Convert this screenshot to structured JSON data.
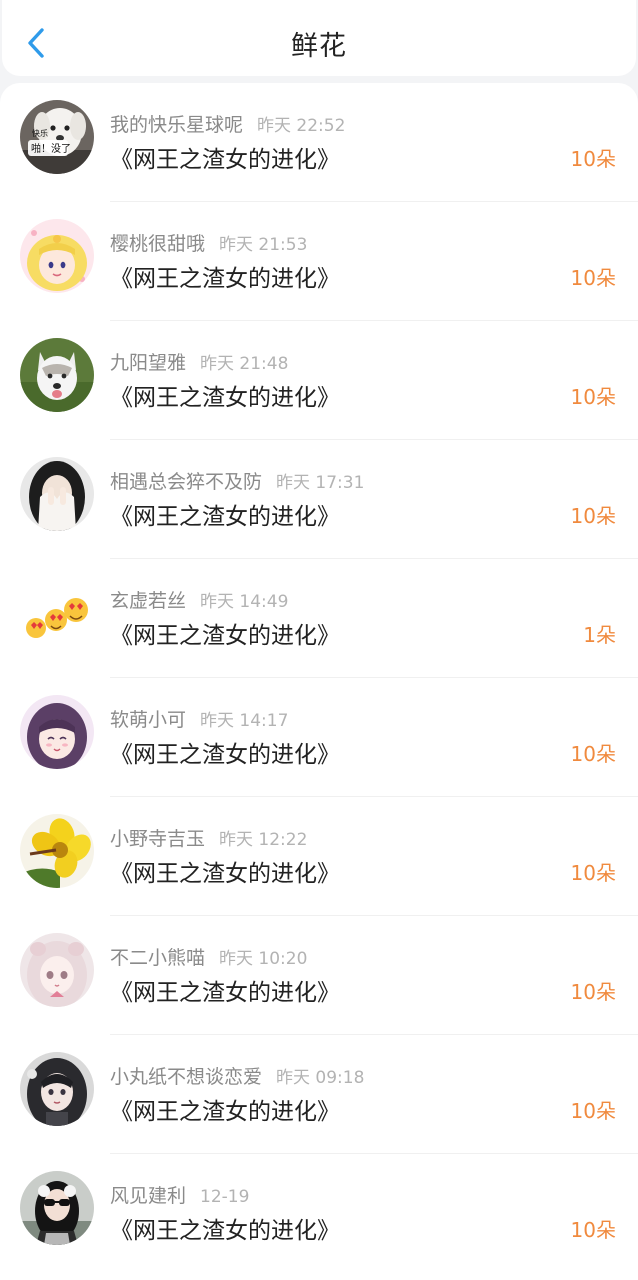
{
  "header": {
    "title": "鲜花",
    "back_icon": "chevron-left-icon",
    "accent_color": "#2f9bea"
  },
  "count_color": "#f08a3e",
  "items": [
    {
      "username": "我的快乐星球呢",
      "time": "昨天 22:52",
      "book": "《网王之渣女的进化》",
      "count": "10朵",
      "avatar": "white-puppy-avatar",
      "avatar_text": "快乐\n啪！没了"
    },
    {
      "username": "樱桃很甜哦",
      "time": "昨天 21:53",
      "book": "《网王之渣女的进化》",
      "count": "10朵",
      "avatar": "sailor-moon-avatar"
    },
    {
      "username": "九阳望雅",
      "time": "昨天 21:48",
      "book": "《网王之渣女的进化》",
      "count": "10朵",
      "avatar": "husky-dog-avatar"
    },
    {
      "username": "相遇总会猝不及防",
      "time": "昨天 17:31",
      "book": "《网王之渣女的进化》",
      "count": "10朵",
      "avatar": "girl-covering-face-avatar"
    },
    {
      "username": "玄虚若丝",
      "time": "昨天 14:49",
      "book": "《网王之渣女的进化》",
      "count": "1朵",
      "avatar": "heart-eyes-emoji-avatar"
    },
    {
      "username": "软萌小可",
      "time": "昨天 14:17",
      "book": "《网王之渣女的进化》",
      "count": "10朵",
      "avatar": "anime-girl-purple-hair-avatar"
    },
    {
      "username": "小野寺吉玉",
      "time": "昨天 12:22",
      "book": "《网王之渣女的进化》",
      "count": "10朵",
      "avatar": "yellow-flower-avatar"
    },
    {
      "username": "不二小熊喵",
      "time": "昨天 10:20",
      "book": "《网王之渣女的进化》",
      "count": "10朵",
      "avatar": "anime-girl-pink-avatar"
    },
    {
      "username": "小丸纸不想谈恋爱",
      "time": "昨天 09:18",
      "book": "《网王之渣女的进化》",
      "count": "10朵",
      "avatar": "anime-girl-dark-hair-avatar"
    },
    {
      "username": "风见建利",
      "time": "12-19",
      "book": "《网王之渣女的进化》",
      "count": "10朵",
      "avatar": "girl-sunglasses-avatar"
    }
  ]
}
